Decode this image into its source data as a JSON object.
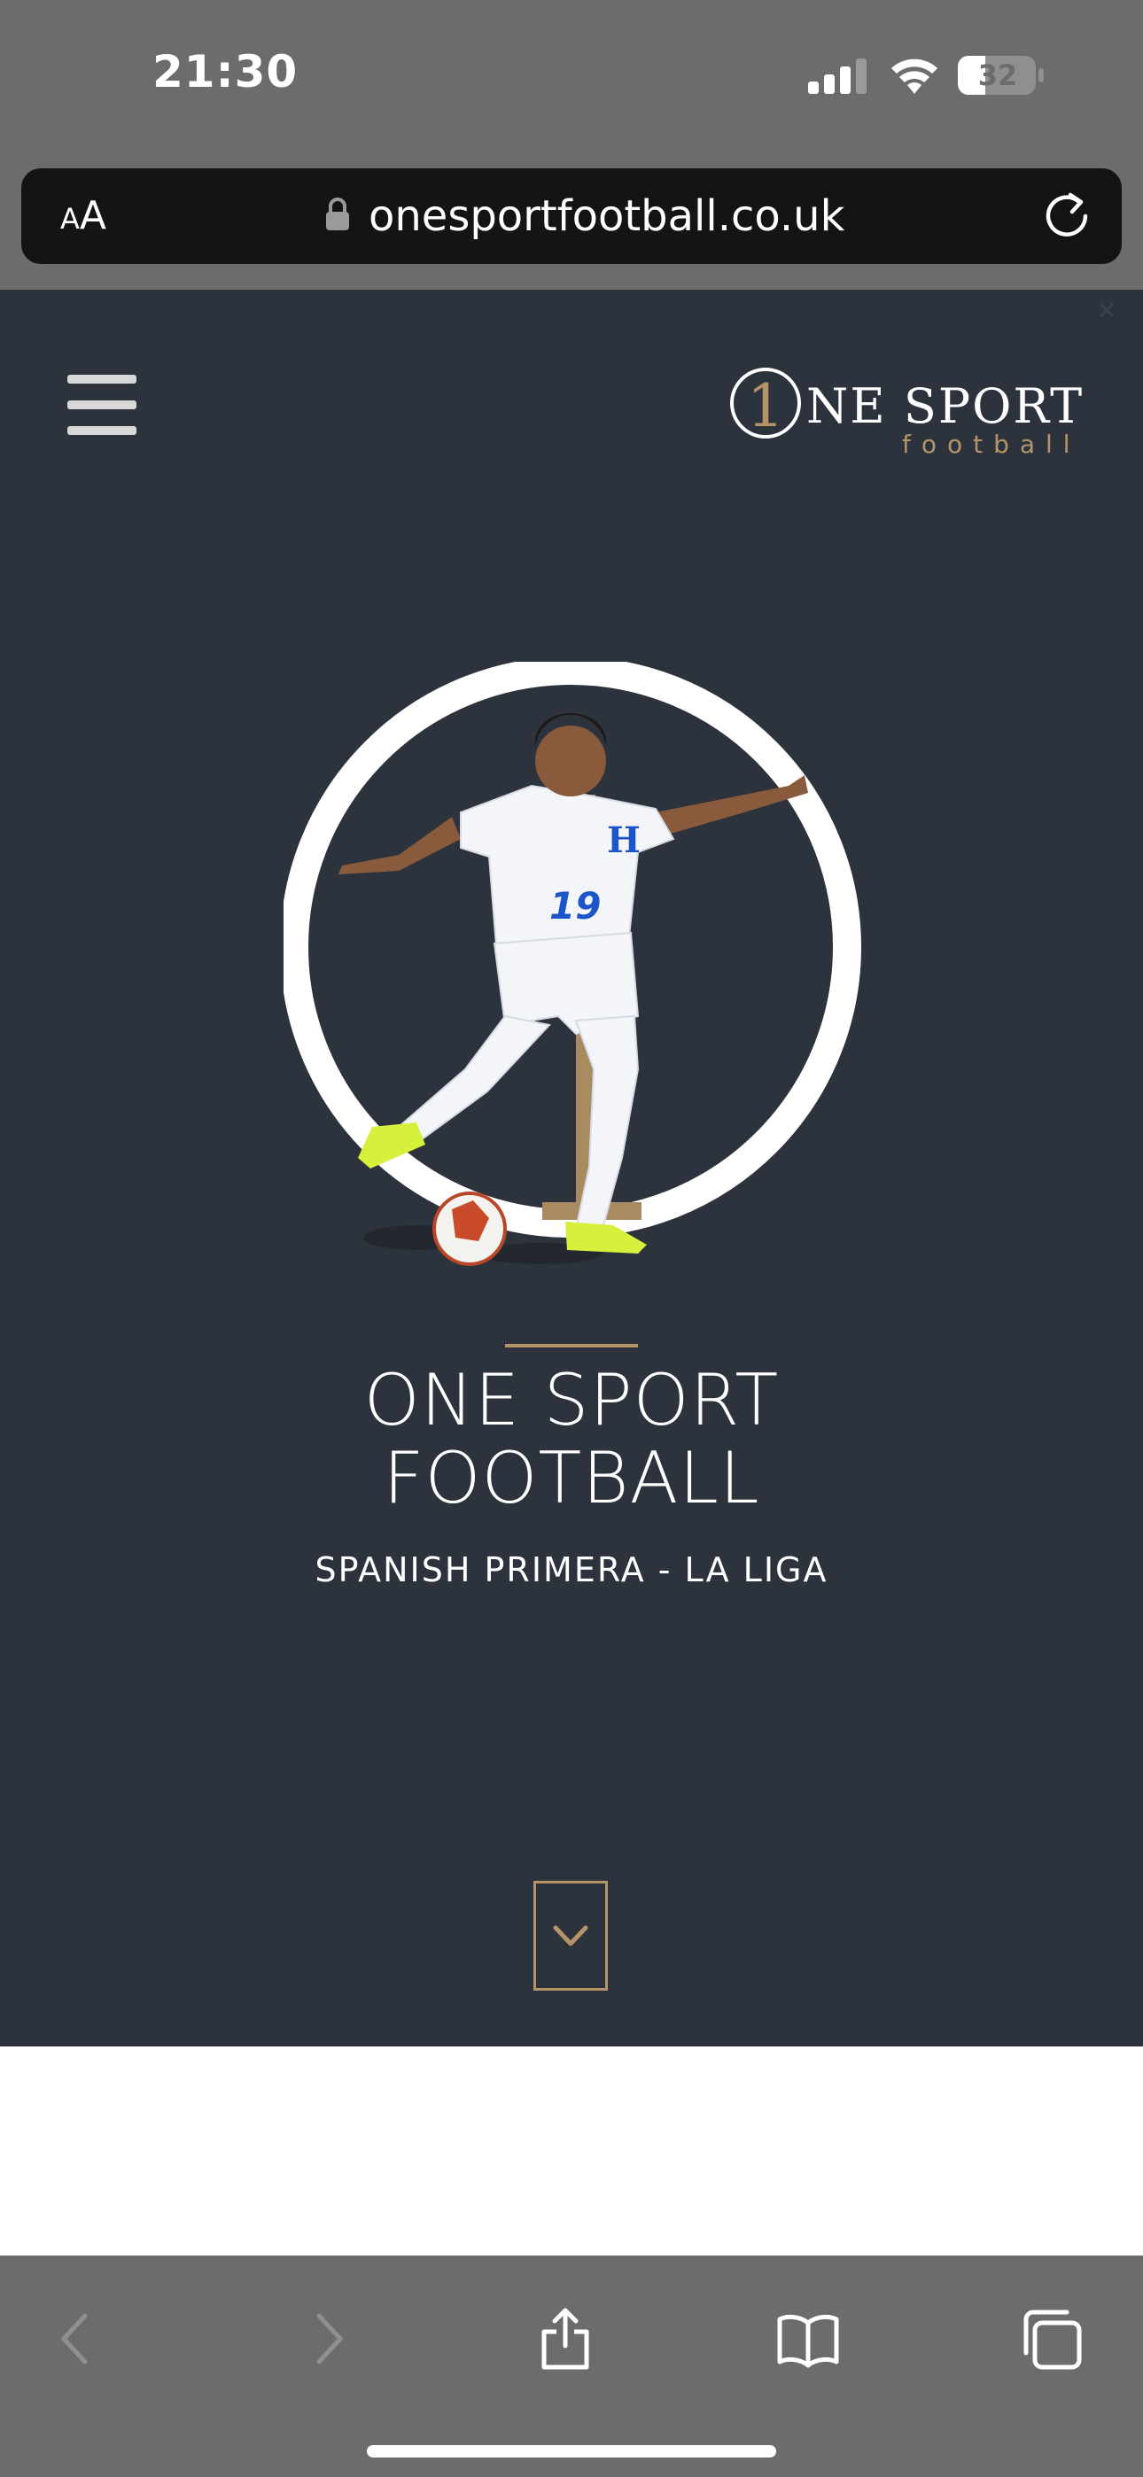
{
  "status_bar": {
    "time": "21:30",
    "battery": "32"
  },
  "browser": {
    "text_size_label_small": "A",
    "text_size_label_large": "A",
    "url": "onesportfootball.co.uk"
  },
  "site": {
    "logo": {
      "numeral": "1",
      "word_top": "NE SPORT",
      "word_bottom": "football"
    },
    "hero": {
      "jersey_number": "19",
      "jersey_letter": "H"
    },
    "title_line1": "ONE SPORT",
    "title_line2": "FOOTBALL",
    "subtitle": "SPANISH PRIMERA - LA LIGA"
  },
  "colors": {
    "site_background": "#2d333c",
    "accent_gold": "#b49468",
    "chrome_gray": "#6c6c6c",
    "address_bar": "#141414"
  }
}
